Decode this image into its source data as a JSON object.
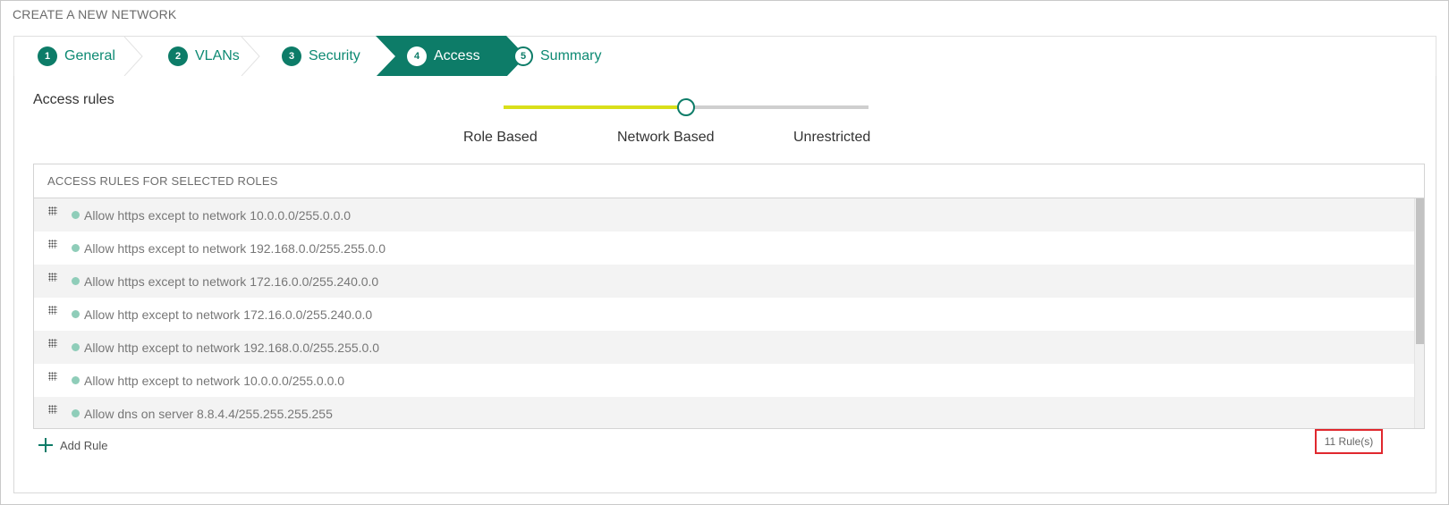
{
  "page": {
    "title": "CREATE A NEW NETWORK"
  },
  "wizard": {
    "steps": [
      {
        "num": "1",
        "label": "General"
      },
      {
        "num": "2",
        "label": "VLANs"
      },
      {
        "num": "3",
        "label": "Security"
      },
      {
        "num": "4",
        "label": "Access"
      },
      {
        "num": "5",
        "label": "Summary"
      }
    ],
    "active_step": "Access",
    "accent_color": "#0d7c68"
  },
  "access": {
    "label": "Access rules",
    "slider": {
      "options": [
        "Role Based",
        "Network Based",
        "Unrestricted"
      ],
      "selected": "Network Based",
      "fill_color": "#d9df1a"
    }
  },
  "rules": {
    "header": "ACCESS RULES FOR SELECTED ROLES",
    "items": [
      "Allow https except to network 10.0.0.0/255.0.0.0",
      "Allow https except to network 192.168.0.0/255.255.0.0",
      "Allow https except to network 172.16.0.0/255.240.0.0",
      "Allow http except to network 172.16.0.0/255.240.0.0",
      "Allow http except to network 192.168.0.0/255.255.0.0",
      "Allow http except to network 10.0.0.0/255.0.0.0",
      "Allow dns on server 8.8.4.4/255.255.255.255"
    ],
    "add_label": "Add Rule",
    "count_label": "11 Rule(s)"
  }
}
